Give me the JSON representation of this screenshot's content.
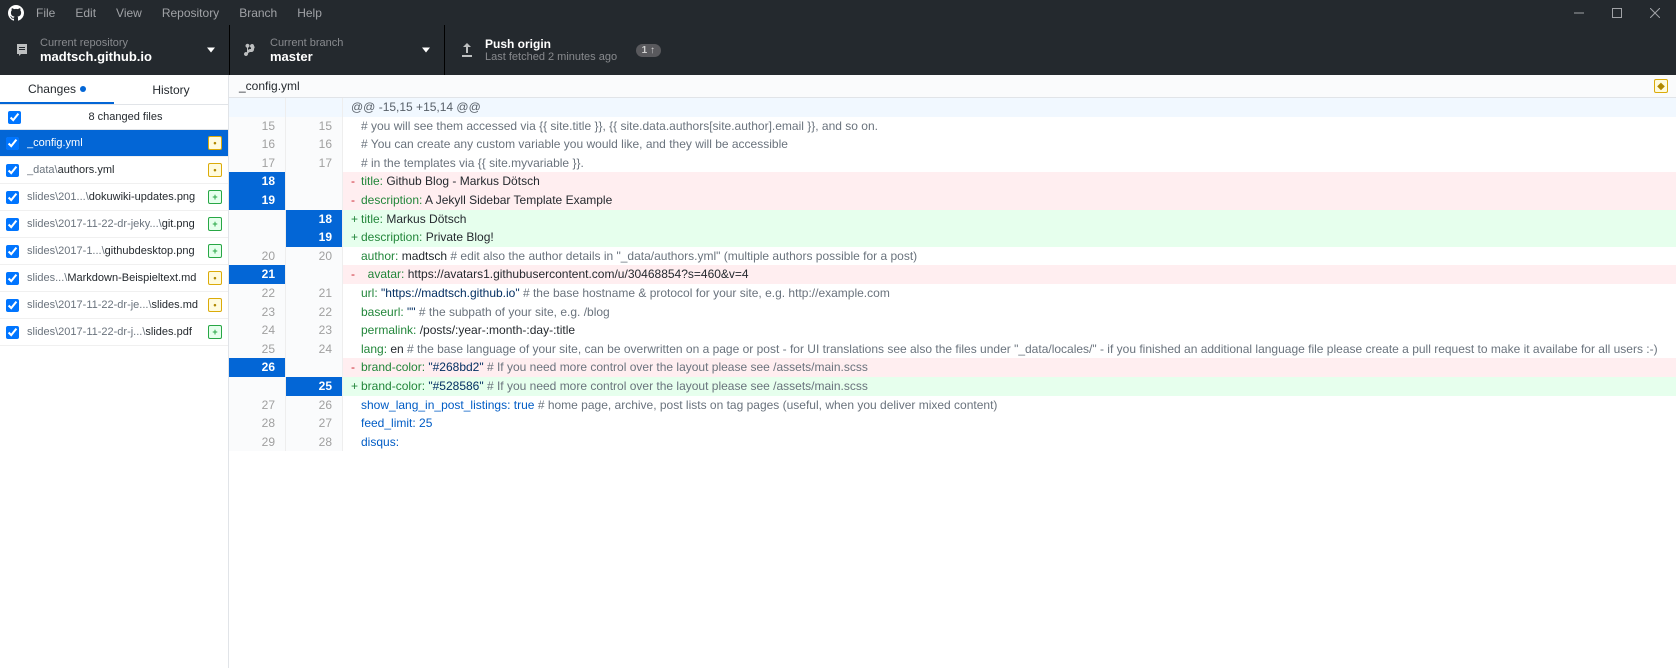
{
  "menu": [
    "File",
    "Edit",
    "View",
    "Repository",
    "Branch",
    "Help"
  ],
  "repo": {
    "label": "Current repository",
    "name": "madtsch.github.io"
  },
  "branch": {
    "label": "Current branch",
    "name": "master"
  },
  "push": {
    "title": "Push origin",
    "sub": "Last fetched 2 minutes ago",
    "badge": "1 ↑"
  },
  "tabs": {
    "changes": "Changes",
    "history": "History"
  },
  "summary": "8 changed files",
  "files": [
    {
      "name": "_config.yml",
      "status": "M",
      "selected": true
    },
    {
      "prefix": "_data\\",
      "name": "authors.yml",
      "status": "M"
    },
    {
      "prefix": "slides\\201...\\",
      "name": "dokuwiki-updates.png",
      "status": "A"
    },
    {
      "prefix": "slides\\2017-11-22-dr-jeky...\\",
      "name": "git.png",
      "status": "A"
    },
    {
      "prefix": "slides\\2017-1...\\",
      "name": "githubdesktop.png",
      "status": "A"
    },
    {
      "prefix": "slides...\\",
      "name": "Markdown-Beispieltext.md",
      "status": "M"
    },
    {
      "prefix": "slides\\2017-11-22-dr-je...\\",
      "name": "slides.md",
      "status": "M"
    },
    {
      "prefix": "slides\\2017-11-22-dr-j...\\",
      "name": "slides.pdf",
      "status": "A"
    }
  ],
  "currentFile": "_config.yml",
  "diff": [
    {
      "t": "hunk",
      "text": "@@ -15,15 +15,14 @@"
    },
    {
      "t": "ctx",
      "a": "15",
      "b": "15",
      "html": "<span class='c'># you will see them accessed via {{ site.title }}, {{ site.data.authors[site.author].email }}, and so on.</span>"
    },
    {
      "t": "ctx",
      "a": "16",
      "b": "16",
      "html": "<span class='c'># You can create any custom variable you would like, and they will be accessible</span>"
    },
    {
      "t": "ctx",
      "a": "17",
      "b": "17",
      "html": "<span class='c'># in the templates via {{ site.myvariable }}.</span>"
    },
    {
      "t": "del",
      "a": "18",
      "hl": "a",
      "html": "<span class='k'>title:</span> Github Blog - Markus Dötsch"
    },
    {
      "t": "del",
      "a": "19",
      "hl": "a",
      "html": "<span class='k'>description:</span> A Jekyll Sidebar Template Example"
    },
    {
      "t": "add",
      "b": "18",
      "hl": "b",
      "html": "<span class='k'>title:</span> Markus Dötsch"
    },
    {
      "t": "add",
      "b": "19",
      "hl": "b",
      "html": "<span class='k'>description:</span> Private Blog!"
    },
    {
      "t": "ctx",
      "a": "20",
      "b": "20",
      "html": "<span class='k'>author:</span> madtsch <span class='c'># edit also the author details in \"_data/authors.yml\" (multiple authors possible for a post)</span>"
    },
    {
      "t": "del",
      "a": "21",
      "hl": "a",
      "html": "  <span class='k'>avatar:</span> https://avatars1.githubusercontent.com/u/30468854?s=460&amp;v=4"
    },
    {
      "t": "ctx",
      "a": "22",
      "b": "21",
      "html": "<span class='k'>url:</span> <span class='s'>\"https://madtsch.github.io\"</span> <span class='c'># the base hostname &amp; protocol for your site, e.g. http://example.com</span>"
    },
    {
      "t": "ctx",
      "a": "23",
      "b": "22",
      "html": "<span class='k'>baseurl:</span> <span class='s'>\"\"</span> <span class='c'># the subpath of your site, e.g. /blog</span>"
    },
    {
      "t": "ctx",
      "a": "24",
      "b": "23",
      "html": "<span class='k'>permalink:</span> /posts/:year-:month-:day-:title"
    },
    {
      "t": "ctx",
      "a": "25",
      "b": "24",
      "html": "<span class='k'>lang:</span> en <span class='c'># the base language of your site, can be overwritten on a page or post - for UI translations see also the files under \"_data/locales/\" - if you finished an additional language file please create a pull request to make it availabe for all users :-)</span>",
      "wrap": true
    },
    {
      "t": "del",
      "a": "26",
      "hl": "a",
      "html": "<span class='k'>brand-color:</span> <span class='s'>\"#268bd2\"</span> <span class='c'># If you need more control over the layout please see /assets/main.scss</span>"
    },
    {
      "t": "add",
      "b": "25",
      "hl": "b",
      "html": "<span class='k'>brand-color:</span> <span class='s'>\"#528586\"</span> <span class='c'># If you need more control over the layout please see /assets/main.scss</span>"
    },
    {
      "t": "ctx",
      "a": "27",
      "b": "26",
      "html": "<span class='k2'>show_lang_in_post_listings:</span> <span class='n'>true</span> <span class='c'># home page, archive, post lists on tag pages (useful, when you deliver mixed content)</span>"
    },
    {
      "t": "ctx",
      "a": "28",
      "b": "27",
      "html": "<span class='k2'>feed_limit:</span> <span class='n'>25</span>"
    },
    {
      "t": "ctx",
      "a": "29",
      "b": "28",
      "html": "<span class='k2'>disqus:</span>"
    }
  ]
}
